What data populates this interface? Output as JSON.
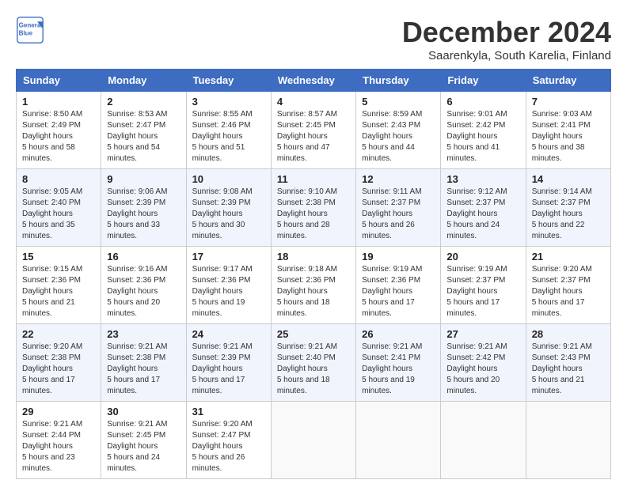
{
  "logo": {
    "line1": "General",
    "line2": "Blue"
  },
  "title": "December 2024",
  "subtitle": "Saarenkyla, South Karelia, Finland",
  "headers": [
    "Sunday",
    "Monday",
    "Tuesday",
    "Wednesday",
    "Thursday",
    "Friday",
    "Saturday"
  ],
  "weeks": [
    [
      {
        "day": "1",
        "rise": "8:50 AM",
        "set": "2:49 PM",
        "daylight": "5 hours and 58 minutes."
      },
      {
        "day": "2",
        "rise": "8:53 AM",
        "set": "2:47 PM",
        "daylight": "5 hours and 54 minutes."
      },
      {
        "day": "3",
        "rise": "8:55 AM",
        "set": "2:46 PM",
        "daylight": "5 hours and 51 minutes."
      },
      {
        "day": "4",
        "rise": "8:57 AM",
        "set": "2:45 PM",
        "daylight": "5 hours and 47 minutes."
      },
      {
        "day": "5",
        "rise": "8:59 AM",
        "set": "2:43 PM",
        "daylight": "5 hours and 44 minutes."
      },
      {
        "day": "6",
        "rise": "9:01 AM",
        "set": "2:42 PM",
        "daylight": "5 hours and 41 minutes."
      },
      {
        "day": "7",
        "rise": "9:03 AM",
        "set": "2:41 PM",
        "daylight": "5 hours and 38 minutes."
      }
    ],
    [
      {
        "day": "8",
        "rise": "9:05 AM",
        "set": "2:40 PM",
        "daylight": "5 hours and 35 minutes."
      },
      {
        "day": "9",
        "rise": "9:06 AM",
        "set": "2:39 PM",
        "daylight": "5 hours and 33 minutes."
      },
      {
        "day": "10",
        "rise": "9:08 AM",
        "set": "2:39 PM",
        "daylight": "5 hours and 30 minutes."
      },
      {
        "day": "11",
        "rise": "9:10 AM",
        "set": "2:38 PM",
        "daylight": "5 hours and 28 minutes."
      },
      {
        "day": "12",
        "rise": "9:11 AM",
        "set": "2:37 PM",
        "daylight": "5 hours and 26 minutes."
      },
      {
        "day": "13",
        "rise": "9:12 AM",
        "set": "2:37 PM",
        "daylight": "5 hours and 24 minutes."
      },
      {
        "day": "14",
        "rise": "9:14 AM",
        "set": "2:37 PM",
        "daylight": "5 hours and 22 minutes."
      }
    ],
    [
      {
        "day": "15",
        "rise": "9:15 AM",
        "set": "2:36 PM",
        "daylight": "5 hours and 21 minutes."
      },
      {
        "day": "16",
        "rise": "9:16 AM",
        "set": "2:36 PM",
        "daylight": "5 hours and 20 minutes."
      },
      {
        "day": "17",
        "rise": "9:17 AM",
        "set": "2:36 PM",
        "daylight": "5 hours and 19 minutes."
      },
      {
        "day": "18",
        "rise": "9:18 AM",
        "set": "2:36 PM",
        "daylight": "5 hours and 18 minutes."
      },
      {
        "day": "19",
        "rise": "9:19 AM",
        "set": "2:36 PM",
        "daylight": "5 hours and 17 minutes."
      },
      {
        "day": "20",
        "rise": "9:19 AM",
        "set": "2:37 PM",
        "daylight": "5 hours and 17 minutes."
      },
      {
        "day": "21",
        "rise": "9:20 AM",
        "set": "2:37 PM",
        "daylight": "5 hours and 17 minutes."
      }
    ],
    [
      {
        "day": "22",
        "rise": "9:20 AM",
        "set": "2:38 PM",
        "daylight": "5 hours and 17 minutes."
      },
      {
        "day": "23",
        "rise": "9:21 AM",
        "set": "2:38 PM",
        "daylight": "5 hours and 17 minutes."
      },
      {
        "day": "24",
        "rise": "9:21 AM",
        "set": "2:39 PM",
        "daylight": "5 hours and 17 minutes."
      },
      {
        "day": "25",
        "rise": "9:21 AM",
        "set": "2:40 PM",
        "daylight": "5 hours and 18 minutes."
      },
      {
        "day": "26",
        "rise": "9:21 AM",
        "set": "2:41 PM",
        "daylight": "5 hours and 19 minutes."
      },
      {
        "day": "27",
        "rise": "9:21 AM",
        "set": "2:42 PM",
        "daylight": "5 hours and 20 minutes."
      },
      {
        "day": "28",
        "rise": "9:21 AM",
        "set": "2:43 PM",
        "daylight": "5 hours and 21 minutes."
      }
    ],
    [
      {
        "day": "29",
        "rise": "9:21 AM",
        "set": "2:44 PM",
        "daylight": "5 hours and 23 minutes."
      },
      {
        "day": "30",
        "rise": "9:21 AM",
        "set": "2:45 PM",
        "daylight": "5 hours and 24 minutes."
      },
      {
        "day": "31",
        "rise": "9:20 AM",
        "set": "2:47 PM",
        "daylight": "5 hours and 26 minutes."
      },
      null,
      null,
      null,
      null
    ]
  ],
  "labels": {
    "sunrise": "Sunrise:",
    "sunset": "Sunset:",
    "daylight": "Daylight:"
  }
}
